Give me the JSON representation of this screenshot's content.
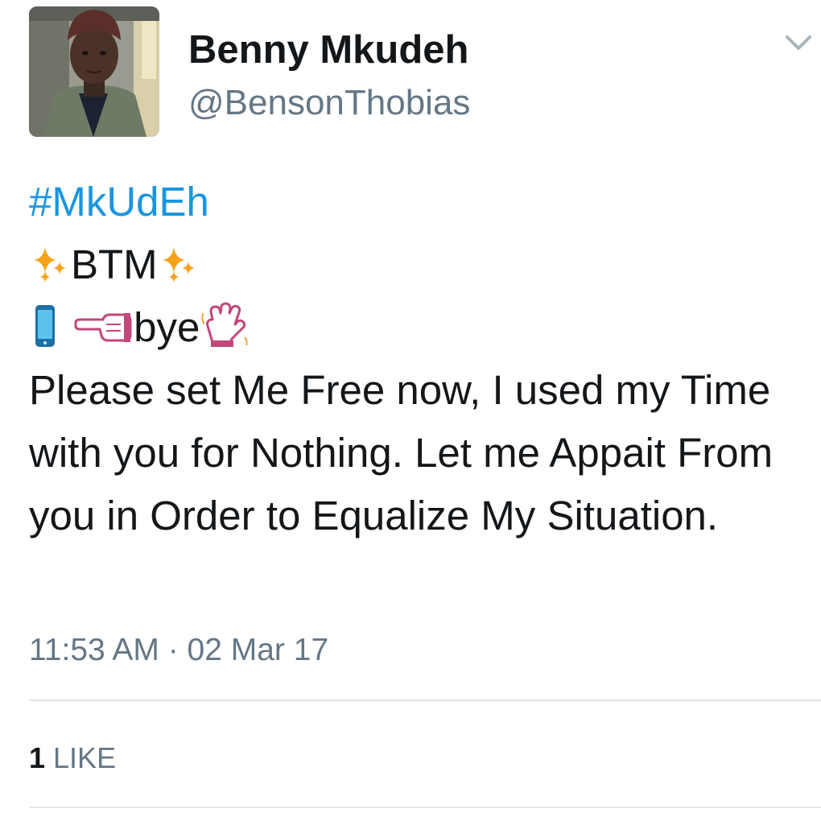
{
  "header": {
    "display_name": "Benny Mkudeh",
    "handle": "@BensonThobias",
    "menu_icon": "chevron-down-icon"
  },
  "tweet": {
    "hashtag": "#MkUdEh",
    "line2_text": "BTM",
    "line3_text": "bye",
    "body": "Please set Me Free now, I used my Time with you for Nothing. Let me Appait From you in Order to Equalize My Situation.",
    "emojis": [
      "sparkles-icon",
      "sparkles-icon",
      "mobile-phone-icon",
      "pointing-left-icon",
      "waving-hand-icon"
    ]
  },
  "meta": {
    "timestamp": "11:53 AM · 02 Mar 17"
  },
  "stats": {
    "like_count": "1",
    "like_label": "LIKE"
  },
  "colors": {
    "hashtag": "#1b95e0",
    "secondary_text": "#657786",
    "primary_text": "#14171a",
    "divider": "#e1e8ed"
  }
}
